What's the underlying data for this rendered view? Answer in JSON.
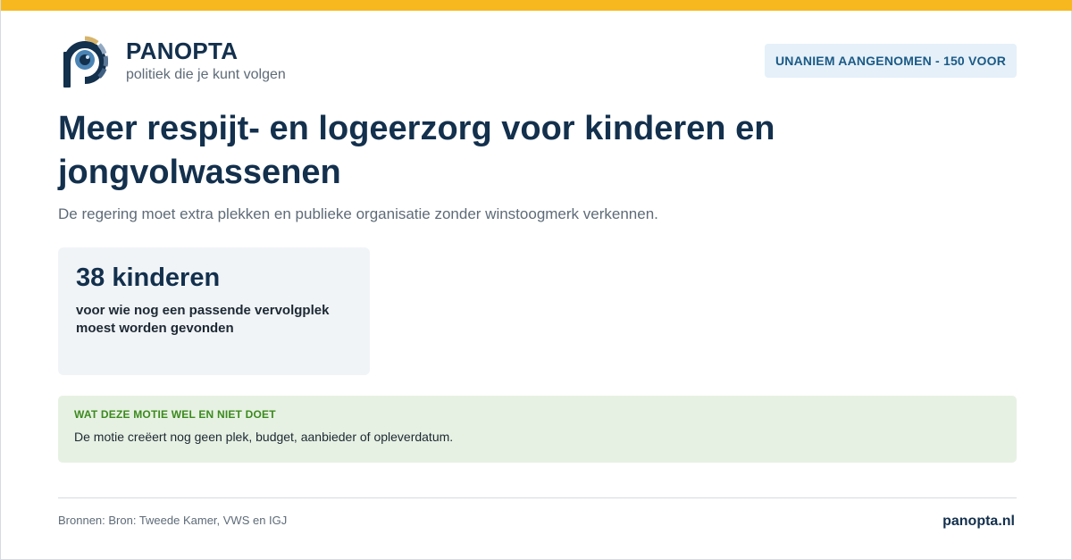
{
  "brand": {
    "name": "PANOPTA",
    "tagline": "politiek die je kunt volgen",
    "colors": {
      "primary": "#13304d",
      "accent": "#f7b81f",
      "eye": "#4a84b4"
    },
    "logo_icon": "eye-p-logo-icon"
  },
  "status_badge": "UNANIEM AANGENOMEN - 150 VOOR",
  "motion": {
    "title": "Meer respijt- en logeerzorg voor kinderen en jongvolwassenen",
    "subtitle": "De regering moet extra plekken en publieke organisatie zonder winstoogmerk verkennen."
  },
  "stat": {
    "value": "38 kinderen",
    "description": "voor wie nog een passende vervolgplek moest worden gevonden"
  },
  "note": {
    "heading": "WAT DEZE MOTIE WEL EN NIET DOET",
    "text": "De motie creëert nog geen plek, budget, aanbieder of opleverdatum."
  },
  "footer": {
    "sources": "Bronnen: Bron: Tweede Kamer, VWS en IGJ",
    "site": "panopta.nl"
  }
}
